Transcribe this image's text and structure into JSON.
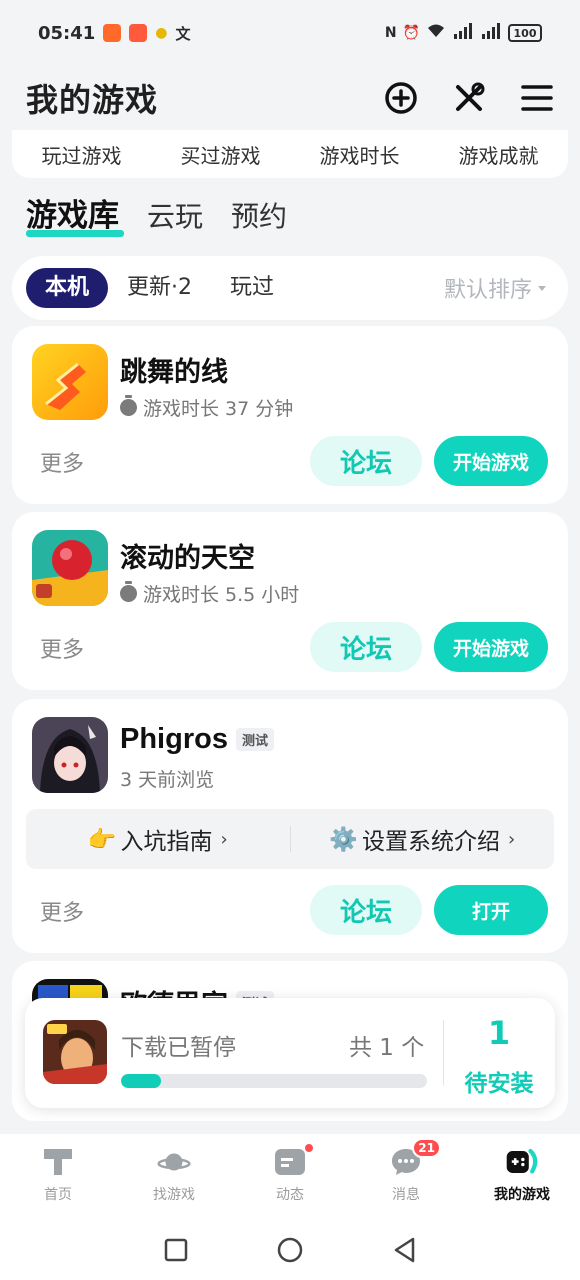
{
  "status_bar": {
    "time": "05:41",
    "battery": "100"
  },
  "header": {
    "title": "我的游戏"
  },
  "stats": [
    "玩过游戏",
    "买过游戏",
    "游戏时长",
    "游戏成就"
  ],
  "main_tabs": [
    "游戏库",
    "云玩",
    "预约"
  ],
  "filters": {
    "chips": [
      "本机",
      "更新·2",
      "玩过"
    ],
    "sort": "默认排序"
  },
  "games": [
    {
      "name": "跳舞的线",
      "meta": "游戏时长 37 分钟",
      "more": "更多",
      "forum": "论坛",
      "action": "开始游戏"
    },
    {
      "name": "滚动的天空",
      "meta": "游戏时长 5.5 小时",
      "more": "更多",
      "forum": "论坛",
      "action": "开始游戏"
    },
    {
      "name": "Phigros",
      "tag": "测试",
      "meta": "3 天前浏览",
      "guides": [
        "入坑指南",
        "设置系统介绍"
      ],
      "more": "更多",
      "forum": "论坛",
      "action": "打开"
    },
    {
      "name": "欧德思家",
      "tag": "测试"
    }
  ],
  "download": {
    "status": "下载已暂停",
    "count": "共 1 个",
    "pending_count": "1",
    "pending_label": "待安装",
    "progress": 0.13
  },
  "bottom_nav": {
    "items": [
      {
        "label": "首页"
      },
      {
        "label": "找游戏"
      },
      {
        "label": "动态"
      },
      {
        "label": "消息",
        "badge": "21"
      },
      {
        "label": "我的游戏"
      }
    ]
  },
  "colors": {
    "accent": "#10d4bd",
    "chip_active": "#1e1d6e",
    "badge": "#ff4d4f"
  }
}
